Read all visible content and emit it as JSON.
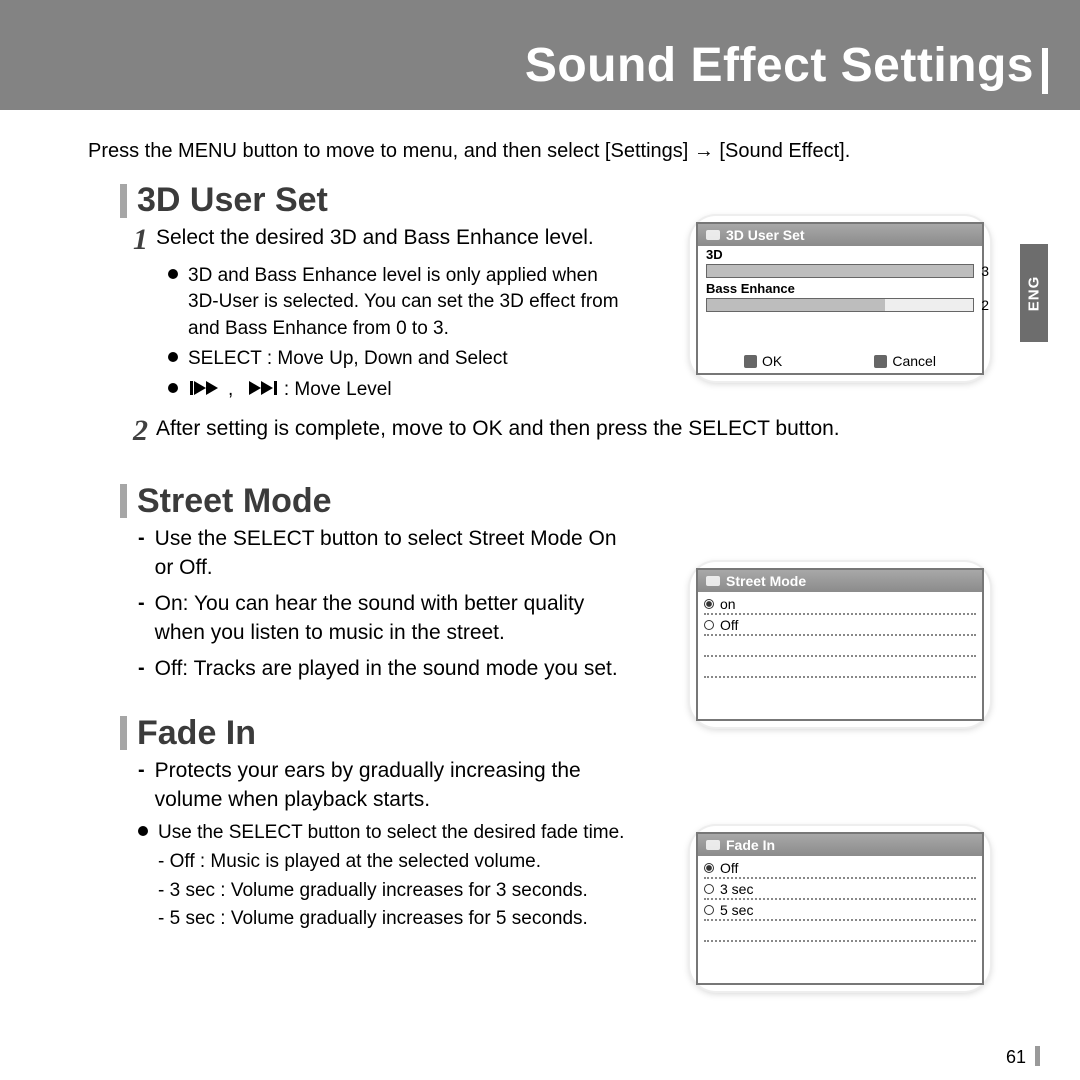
{
  "page": {
    "title": "Sound Effect Settings",
    "intro": "Press the MENU button to move to menu, and then select [Settings] → [Sound Effect].",
    "lang_tab": "ENG",
    "page_number": "61"
  },
  "sections": {
    "s3d": {
      "heading": "3D User Set",
      "step1": "Select the desired 3D and Bass Enhance level.",
      "bullets": [
        "3D and Bass Enhance level is only applied when 3D-User is selected. You can set the 3D effect from and Bass Enhance from 0 to 3.",
        "SELECT : Move Up, Down and Select",
        " : Move Level"
      ],
      "step2": "After setting is complete, move to OK and then press the SELECT button."
    },
    "street": {
      "heading": "Street Mode",
      "items": [
        "Use the SELECT button to select Street Mode On or Off.",
        "On: You can hear the sound with better quality when you listen to music in the street.",
        "Off: Tracks are played in the sound mode you set."
      ]
    },
    "fade": {
      "heading": "Fade In",
      "d1": "Protects your ears by gradually increasing the volume when playback starts.",
      "b1": "Use the SELECT button to select the desired fade time.",
      "sub": [
        "- Off : Music is played at the selected volume.",
        "- 3 sec : Volume gradually increases for 3 seconds.",
        "- 5 sec : Volume gradually increases for 5 seconds."
      ]
    }
  },
  "device1": {
    "header": "3D User Set",
    "row1_label": "3D",
    "row1_val": "3",
    "row2_label": "Bass Enhance",
    "row2_val": "2",
    "ok": "OK",
    "cancel": "Cancel"
  },
  "device2": {
    "header": "Street Mode",
    "opts": [
      "on",
      "Off"
    ],
    "selected": 0
  },
  "device3": {
    "header": "Fade In",
    "opts": [
      "Off",
      "3 sec",
      "5 sec"
    ],
    "selected": 0
  }
}
